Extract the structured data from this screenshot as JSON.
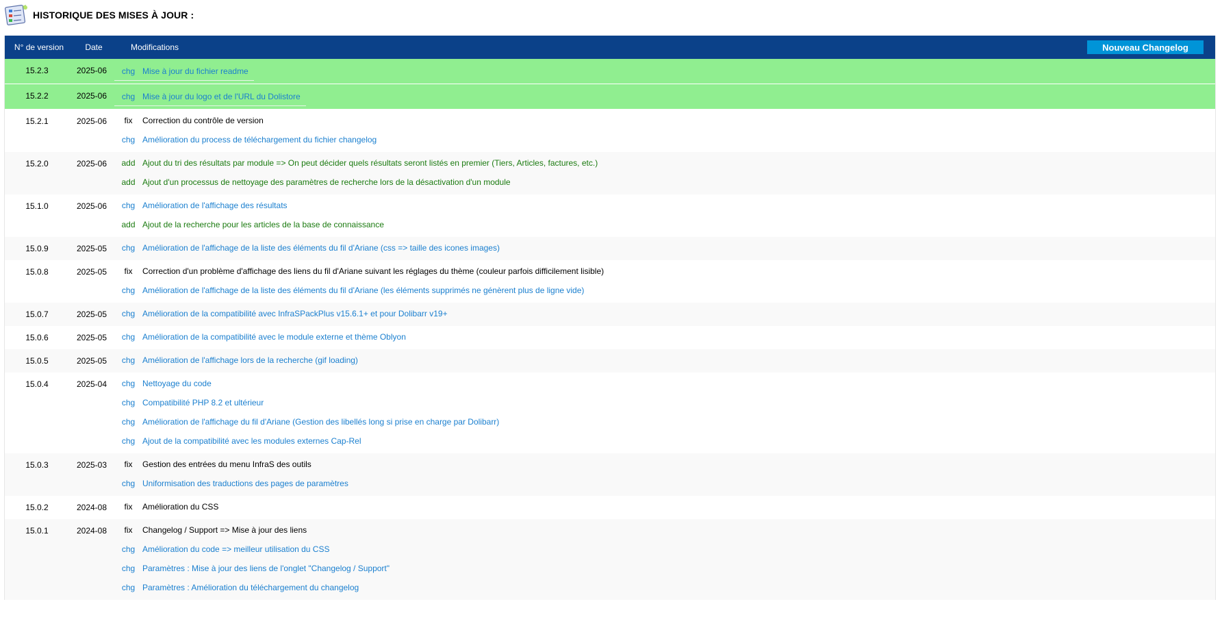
{
  "page": {
    "title": "HISTORIQUE DES MISES À JOUR :",
    "icon": "document-list-icon"
  },
  "table": {
    "headers": {
      "version": "N° de version",
      "date": "Date",
      "modifications": "Modifications"
    },
    "new_button": "Nouveau Changelog",
    "colors": {
      "header_bg": "#0b4189",
      "button_bg": "#0094d8",
      "highlight_bg": "#90ee90",
      "chg": "#1a7fcf",
      "add": "#1a7a0f",
      "fix": "#000000"
    },
    "rows": [
      {
        "version": "15.2.3",
        "date": "2025-06",
        "highlight": true,
        "mods": [
          {
            "type": "chg",
            "text": "Mise à jour du fichier readme"
          }
        ]
      },
      {
        "version": "15.2.2",
        "date": "2025-06",
        "highlight": true,
        "mods": [
          {
            "type": "chg",
            "text": "Mise à jour du logo et de l'URL du Dolistore"
          }
        ]
      },
      {
        "version": "15.2.1",
        "date": "2025-06",
        "mods": [
          {
            "type": "fix",
            "text": "Correction du contrôle de version"
          },
          {
            "type": "chg",
            "text": "Amélioration du process de téléchargement du fichier changelog"
          }
        ]
      },
      {
        "version": "15.2.0",
        "date": "2025-06",
        "mods": [
          {
            "type": "add",
            "text": "Ajout du tri des résultats par module => On peut décider quels résultats seront listés en premier (Tiers, Articles, factures, etc.)"
          },
          {
            "type": "add",
            "text": "Ajout d'un processus de nettoyage des paramètres de recherche lors de la désactivation d'un module"
          }
        ]
      },
      {
        "version": "15.1.0",
        "date": "2025-06",
        "mods": [
          {
            "type": "chg",
            "text": "Amélioration de l'affichage des résultats"
          },
          {
            "type": "add",
            "text": "Ajout de la recherche pour les articles de la base de connaissance"
          }
        ]
      },
      {
        "version": "15.0.9",
        "date": "2025-05",
        "mods": [
          {
            "type": "chg",
            "text": "Amélioration de l'affichage de la liste des éléments du fil d'Ariane (css => taille des icones images)"
          }
        ]
      },
      {
        "version": "15.0.8",
        "date": "2025-05",
        "mods": [
          {
            "type": "fix",
            "text": "Correction d'un problème d'affichage des liens du fil d'Ariane suivant les réglages du thème (couleur parfois difficilement lisible)"
          },
          {
            "type": "chg",
            "text": "Amélioration de l'affichage de la liste des éléments du fil d'Ariane (les éléments supprimés ne génèrent plus de ligne vide)"
          }
        ]
      },
      {
        "version": "15.0.7",
        "date": "2025-05",
        "mods": [
          {
            "type": "chg",
            "text": "Amélioration de la compatibilité avec InfraSPackPlus v15.6.1+ et pour Dolibarr v19+"
          }
        ]
      },
      {
        "version": "15.0.6",
        "date": "2025-05",
        "mods": [
          {
            "type": "chg",
            "text": "Amélioration de la compatibilité avec le module externe et thème Oblyon"
          }
        ]
      },
      {
        "version": "15.0.5",
        "date": "2025-05",
        "mods": [
          {
            "type": "chg",
            "text": "Amélioration de l'affichage lors de la recherche (gif loading)"
          }
        ]
      },
      {
        "version": "15.0.4",
        "date": "2025-04",
        "mods": [
          {
            "type": "chg",
            "text": "Nettoyage du code"
          },
          {
            "type": "chg",
            "text": "Compatibilité PHP 8.2 et ultérieur"
          },
          {
            "type": "chg",
            "text": "Amélioration de l'affichage du fil d'Ariane (Gestion des libellés long si prise en charge par Dolibarr)"
          },
          {
            "type": "chg",
            "text": "Ajout de la compatibilité avec les modules externes Cap-Rel"
          }
        ]
      },
      {
        "version": "15.0.3",
        "date": "2025-03",
        "mods": [
          {
            "type": "fix",
            "text": "Gestion des entrées du menu InfraS des outils"
          },
          {
            "type": "chg",
            "text": "Uniformisation des traductions des pages de paramètres"
          }
        ]
      },
      {
        "version": "15.0.2",
        "date": "2024-08",
        "mods": [
          {
            "type": "fix",
            "text": "Amélioration du CSS"
          }
        ]
      },
      {
        "version": "15.0.1",
        "date": "2024-08",
        "mods": [
          {
            "type": "fix",
            "text": "Changelog / Support => Mise à jour des liens"
          },
          {
            "type": "chg",
            "text": "Amélioration du code => meilleur utilisation du CSS"
          },
          {
            "type": "chg",
            "text": "Paramètres : Mise à jour des liens de l'onglet \"Changelog / Support\""
          },
          {
            "type": "chg",
            "text": "Paramètres : Amélioration du téléchargement du changelog"
          }
        ]
      }
    ]
  }
}
